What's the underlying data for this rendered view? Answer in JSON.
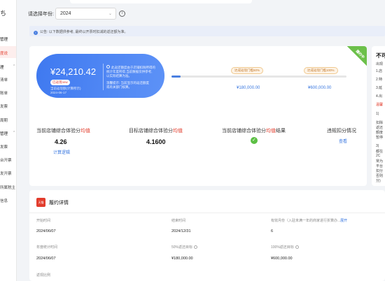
{
  "sidebar": {
    "logo": "ち",
    "items": [
      {
        "label": "管理",
        "type": "group"
      },
      {
        "label": "度说",
        "type": "item",
        "active": true
      },
      {
        "label": "理",
        "type": "group"
      },
      {
        "label": "清单",
        "type": "item"
      },
      {
        "label": "账单",
        "type": "item"
      },
      {
        "label": "发票",
        "type": "item"
      },
      {
        "label": "周期",
        "type": "item"
      },
      {
        "label": "管理",
        "type": "group"
      },
      {
        "label": "发票",
        "type": "item"
      },
      {
        "label": "台开票",
        "type": "item"
      },
      {
        "label": "发开票",
        "type": "item"
      },
      {
        "label": "所属税主",
        "type": "item"
      },
      {
        "label": "信息",
        "type": "item"
      }
    ]
  },
  "filter": {
    "year_label": "请选择年份:",
    "year_value": "2024"
  },
  "notice": {
    "text": "公告: 以下数据供参考, 最终以开票时扣减的返还额为准。",
    "link": "返还额"
  },
  "card": {
    "corner_badge": "履约中",
    "amount": "¥24,210.42",
    "badge": "已返现new",
    "note_line1": "当前返现额(计算所示)",
    "note_line2": "2024-06-17",
    "desc_line1": "此返还额度由于店铺扣除所得的",
    "desc_line2": "统计年度所得,当前数据仅供参考,",
    "desc_line3": "以实际结算为准。",
    "desc_line4": "温馨提示: 当前显示的返还额度",
    "desc_line5": "或有关部门核算。",
    "progress": 0.05,
    "milestone1_label": "达成返现门槛50%",
    "milestone1_value": "¥180,000.00",
    "milestone2_label": "达成返现门槛100%",
    "milestone2_value": "¥600,000.00",
    "stats": [
      {
        "label_pre": "当前店铺综合体验分",
        "label_em": "均值",
        "value": "4.26",
        "link": "计算逻辑"
      },
      {
        "label_pre": "目标店铺综合体验分",
        "label_em": "均值",
        "value": "4.1600"
      },
      {
        "label_pre": "当前店铺综合体验分",
        "label_em": "均值",
        "label_post": "结果"
      },
      {
        "label_pre": "违规扣分情况",
        "link": "查看"
      }
    ]
  },
  "right_panel": {
    "title": "不可",
    "lines": [
      "出现",
      "1.店",
      "2.特",
      "3.延",
      "4.出",
      "温馨",
      "1)",
      "扣除",
      "返还",
      "额度",
      "暂停",
      "3)",
      "都在",
      "2C",
      "常为",
      "平台",
      "扣分",
      "否则",
      "分)"
    ]
  },
  "bottom": {
    "logo": "天猫",
    "title": "履约详情",
    "fields": [
      {
        "label": "开始时间",
        "value": "2024/06/07"
      },
      {
        "label": "结束时间",
        "value": "2024/12/31"
      },
      {
        "label": "有效月份（入驻未满一年的商家进行折算办...",
        "label_link": "展开",
        "value": "6"
      },
      {
        "label": "年度统计时间",
        "value": "2024/06/07"
      },
      {
        "label": "50%返还目标",
        "value": "¥180,000.00"
      },
      {
        "label": "100%返还目标",
        "value": "¥600,000.00"
      },
      {
        "label": "返现比例"
      }
    ]
  }
}
